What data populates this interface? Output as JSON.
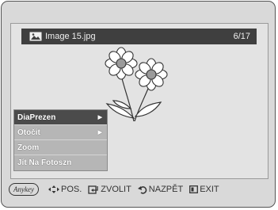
{
  "title_bar": {
    "file_name": "Image 15.jpg",
    "counter": "6/17"
  },
  "menu": {
    "items": [
      {
        "label": "DiaPrezen",
        "submenu": true,
        "selected": true
      },
      {
        "label": "Otočit",
        "submenu": true,
        "selected": false
      },
      {
        "label": "Zoom",
        "submenu": false,
        "selected": false
      },
      {
        "label": "Jít Na Fotoszn",
        "submenu": false,
        "selected": false
      }
    ]
  },
  "hints": {
    "anykey": "Anykey",
    "pos": "POS.",
    "select": "ZVOLIT",
    "back": "NAZPĚT",
    "exit": "EXIT"
  },
  "icons": [
    "image-icon",
    "flower-image",
    "submenu-arrow-icon",
    "navigate-arrows-icon",
    "enter-icon",
    "return-icon",
    "exit-icon"
  ]
}
